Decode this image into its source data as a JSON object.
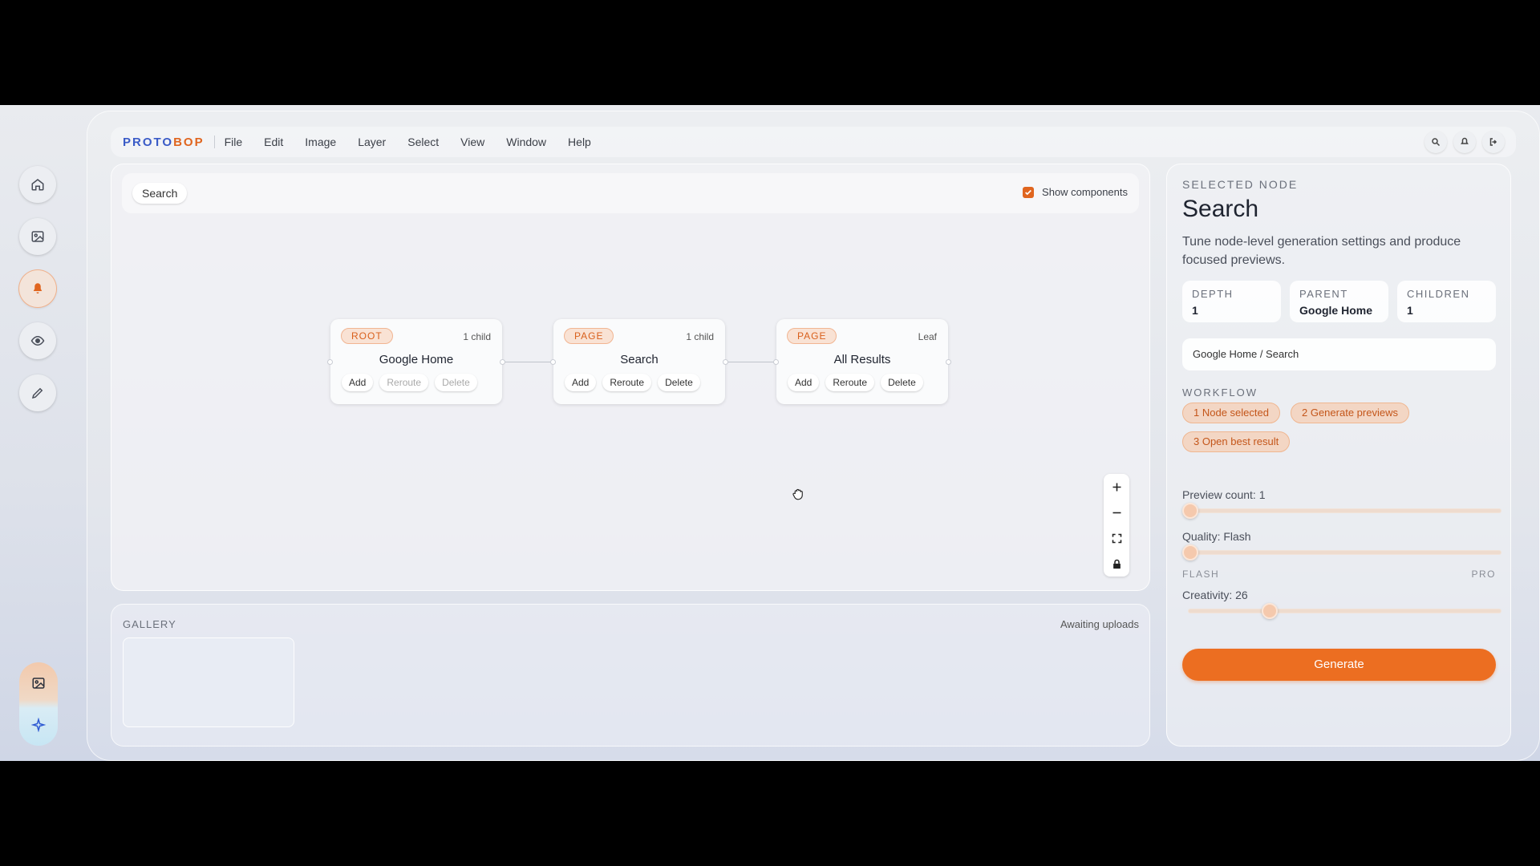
{
  "menubar": {
    "brand_a": "PROTO",
    "brand_b": "BOP",
    "items": [
      "File",
      "Edit",
      "Image",
      "Layer",
      "Select",
      "View",
      "Window",
      "Help"
    ]
  },
  "toolbar": {
    "search_label": "Search",
    "show_components_label": "Show components",
    "show_components_checked": true
  },
  "nodes": [
    {
      "badge": "ROOT",
      "meta": "1 child",
      "title": "Google Home",
      "actions": [
        "Add",
        "Reroute",
        "Delete"
      ],
      "disabled": [
        false,
        true,
        true
      ]
    },
    {
      "badge": "PAGE",
      "meta": "1 child",
      "title": "Search",
      "actions": [
        "Add",
        "Reroute",
        "Delete"
      ],
      "disabled": [
        false,
        false,
        false
      ]
    },
    {
      "badge": "PAGE",
      "meta": "Leaf",
      "title": "All Results",
      "actions": [
        "Add",
        "Reroute",
        "Delete"
      ],
      "disabled": [
        false,
        false,
        false
      ]
    }
  ],
  "gallery": {
    "label": "GALLERY",
    "status": "Awaiting uploads"
  },
  "panel": {
    "eyebrow": "SELECTED NODE",
    "title": "Search",
    "description": "Tune node-level generation settings and produce focused previews.",
    "stats": [
      {
        "key": "DEPTH",
        "value": "1"
      },
      {
        "key": "PARENT",
        "value": "Google Home"
      },
      {
        "key": "CHILDREN",
        "value": "1"
      }
    ],
    "path": "Google Home / Search",
    "workflow_label": "WORKFLOW",
    "workflow_steps": [
      "1 Node selected",
      "2 Generate previews",
      "3 Open best result"
    ],
    "preview_count_label": "Preview count: 1",
    "quality_label": "Quality: Flash",
    "quality_min": "FLASH",
    "quality_max": "PRO",
    "creativity_label": "Creativity: 26",
    "creativity_value": 26,
    "generate_label": "Generate"
  },
  "colors": {
    "accent": "#ec6e21",
    "brand_blue": "#3a5bc7"
  }
}
